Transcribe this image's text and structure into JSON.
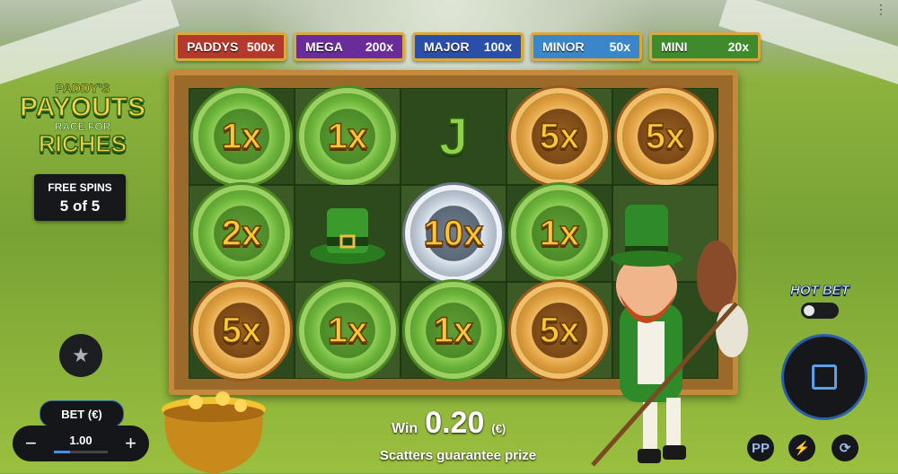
{
  "jackpots": [
    {
      "name": "PADDYS",
      "value": "500x",
      "color": "#b3392c"
    },
    {
      "name": "MEGA",
      "value": "200x",
      "color": "#6a2c9a"
    },
    {
      "name": "MAJOR",
      "value": "100x",
      "color": "#2a4fa8"
    },
    {
      "name": "MINOR",
      "value": "50x",
      "color": "#3a86c8"
    },
    {
      "name": "MINI",
      "value": "20x",
      "color": "#3f8a2c"
    }
  ],
  "logo": {
    "line1": "PADDY'S",
    "line2": "PAYOUTS",
    "line3": "RACE FOR",
    "line4": "RICHES"
  },
  "free_spins": {
    "label": "FREE SPINS",
    "value": "5 of 5"
  },
  "grid": [
    [
      "1x",
      "1x",
      "J",
      "5x",
      "5x"
    ],
    [
      "2x",
      "HAT",
      "10x",
      "1x",
      ""
    ],
    [
      "5x",
      "1x",
      "1x",
      "5x",
      ""
    ]
  ],
  "grid_styles": [
    [
      "green",
      "green",
      "jsym",
      "gold",
      "gold"
    ],
    [
      "green",
      "hat",
      "silver",
      "green",
      "blank"
    ],
    [
      "gold",
      "green",
      "green",
      "gold",
      "blank"
    ]
  ],
  "bet": {
    "label": "BET (€)",
    "value": "1.00",
    "minus": "−",
    "plus": "+",
    "level": 0.3
  },
  "win": {
    "label": "Win",
    "value": "0.20",
    "currency": "(€)"
  },
  "scatter_text": "Scatters guarantee prize",
  "hot_bet": {
    "label": "HOT BET"
  },
  "icons": {
    "star": "star-icon",
    "spin": "stop-icon",
    "ppb": "PP",
    "turbo": "⚡",
    "autoplay": "⟳"
  }
}
